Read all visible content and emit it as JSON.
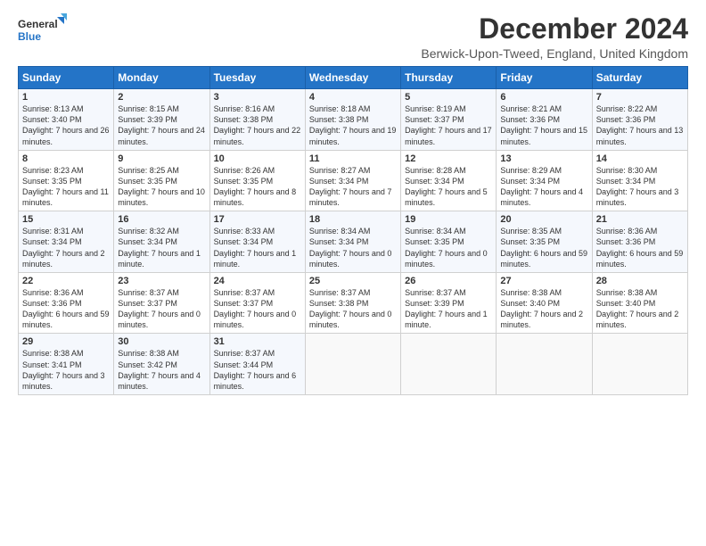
{
  "logo": {
    "line1": "General",
    "line2": "Blue"
  },
  "title": "December 2024",
  "location": "Berwick-Upon-Tweed, England, United Kingdom",
  "days_header": [
    "Sunday",
    "Monday",
    "Tuesday",
    "Wednesday",
    "Thursday",
    "Friday",
    "Saturday"
  ],
  "weeks": [
    [
      {
        "day": "1",
        "sunrise": "8:13 AM",
        "sunset": "3:40 PM",
        "daylight": "7 hours and 26 minutes."
      },
      {
        "day": "2",
        "sunrise": "8:15 AM",
        "sunset": "3:39 PM",
        "daylight": "7 hours and 24 minutes."
      },
      {
        "day": "3",
        "sunrise": "8:16 AM",
        "sunset": "3:38 PM",
        "daylight": "7 hours and 22 minutes."
      },
      {
        "day": "4",
        "sunrise": "8:18 AM",
        "sunset": "3:38 PM",
        "daylight": "7 hours and 19 minutes."
      },
      {
        "day": "5",
        "sunrise": "8:19 AM",
        "sunset": "3:37 PM",
        "daylight": "7 hours and 17 minutes."
      },
      {
        "day": "6",
        "sunrise": "8:21 AM",
        "sunset": "3:36 PM",
        "daylight": "7 hours and 15 minutes."
      },
      {
        "day": "7",
        "sunrise": "8:22 AM",
        "sunset": "3:36 PM",
        "daylight": "7 hours and 13 minutes."
      }
    ],
    [
      {
        "day": "8",
        "sunrise": "8:23 AM",
        "sunset": "3:35 PM",
        "daylight": "7 hours and 11 minutes."
      },
      {
        "day": "9",
        "sunrise": "8:25 AM",
        "sunset": "3:35 PM",
        "daylight": "7 hours and 10 minutes."
      },
      {
        "day": "10",
        "sunrise": "8:26 AM",
        "sunset": "3:35 PM",
        "daylight": "7 hours and 8 minutes."
      },
      {
        "day": "11",
        "sunrise": "8:27 AM",
        "sunset": "3:34 PM",
        "daylight": "7 hours and 7 minutes."
      },
      {
        "day": "12",
        "sunrise": "8:28 AM",
        "sunset": "3:34 PM",
        "daylight": "7 hours and 5 minutes."
      },
      {
        "day": "13",
        "sunrise": "8:29 AM",
        "sunset": "3:34 PM",
        "daylight": "7 hours and 4 minutes."
      },
      {
        "day": "14",
        "sunrise": "8:30 AM",
        "sunset": "3:34 PM",
        "daylight": "7 hours and 3 minutes."
      }
    ],
    [
      {
        "day": "15",
        "sunrise": "8:31 AM",
        "sunset": "3:34 PM",
        "daylight": "7 hours and 2 minutes."
      },
      {
        "day": "16",
        "sunrise": "8:32 AM",
        "sunset": "3:34 PM",
        "daylight": "7 hours and 1 minute."
      },
      {
        "day": "17",
        "sunrise": "8:33 AM",
        "sunset": "3:34 PM",
        "daylight": "7 hours and 1 minute."
      },
      {
        "day": "18",
        "sunrise": "8:34 AM",
        "sunset": "3:34 PM",
        "daylight": "7 hours and 0 minutes."
      },
      {
        "day": "19",
        "sunrise": "8:34 AM",
        "sunset": "3:35 PM",
        "daylight": "7 hours and 0 minutes."
      },
      {
        "day": "20",
        "sunrise": "8:35 AM",
        "sunset": "3:35 PM",
        "daylight": "6 hours and 59 minutes."
      },
      {
        "day": "21",
        "sunrise": "8:36 AM",
        "sunset": "3:36 PM",
        "daylight": "6 hours and 59 minutes."
      }
    ],
    [
      {
        "day": "22",
        "sunrise": "8:36 AM",
        "sunset": "3:36 PM",
        "daylight": "6 hours and 59 minutes."
      },
      {
        "day": "23",
        "sunrise": "8:37 AM",
        "sunset": "3:37 PM",
        "daylight": "7 hours and 0 minutes."
      },
      {
        "day": "24",
        "sunrise": "8:37 AM",
        "sunset": "3:37 PM",
        "daylight": "7 hours and 0 minutes."
      },
      {
        "day": "25",
        "sunrise": "8:37 AM",
        "sunset": "3:38 PM",
        "daylight": "7 hours and 0 minutes."
      },
      {
        "day": "26",
        "sunrise": "8:37 AM",
        "sunset": "3:39 PM",
        "daylight": "7 hours and 1 minute."
      },
      {
        "day": "27",
        "sunrise": "8:38 AM",
        "sunset": "3:40 PM",
        "daylight": "7 hours and 2 minutes."
      },
      {
        "day": "28",
        "sunrise": "8:38 AM",
        "sunset": "3:40 PM",
        "daylight": "7 hours and 2 minutes."
      }
    ],
    [
      {
        "day": "29",
        "sunrise": "8:38 AM",
        "sunset": "3:41 PM",
        "daylight": "7 hours and 3 minutes."
      },
      {
        "day": "30",
        "sunrise": "8:38 AM",
        "sunset": "3:42 PM",
        "daylight": "7 hours and 4 minutes."
      },
      {
        "day": "31",
        "sunrise": "8:37 AM",
        "sunset": "3:44 PM",
        "daylight": "7 hours and 6 minutes."
      },
      null,
      null,
      null,
      null
    ]
  ]
}
